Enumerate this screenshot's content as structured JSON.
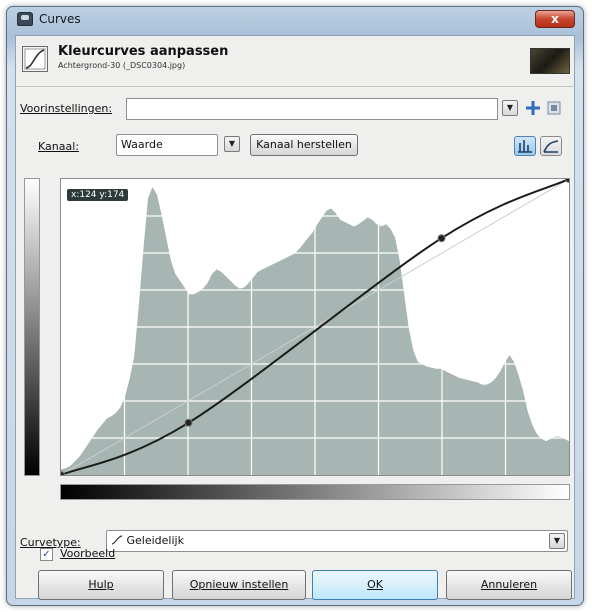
{
  "window": {
    "title": "Curves",
    "close_label": "x"
  },
  "header": {
    "title": "Kleurcurves aanpassen",
    "subtitle": "Achtergrond-30 (_DSC0304.jpg)"
  },
  "presets": {
    "label": "Voorinstellingen:",
    "value": ""
  },
  "channel": {
    "label": "Kanaal:",
    "value": "Waarde",
    "reset_label": "Kanaal herstellen"
  },
  "graph": {
    "coord_readout": "x:124 y:174",
    "curve_points": [
      [
        0,
        0
      ],
      [
        64,
        45
      ],
      [
        191,
        204
      ],
      [
        255,
        255
      ]
    ],
    "histogram": [
      5,
      6,
      8,
      12,
      16,
      22,
      28,
      34,
      40,
      45,
      50,
      52,
      55,
      60,
      70,
      85,
      105,
      150,
      200,
      245,
      255,
      248,
      230,
      210,
      190,
      178,
      172,
      166,
      160,
      160,
      162,
      165,
      170,
      178,
      182,
      180,
      176,
      172,
      168,
      165,
      166,
      170,
      175,
      180,
      182,
      184,
      186,
      188,
      190,
      192,
      194,
      196,
      200,
      205,
      210,
      215,
      222,
      228,
      234,
      236,
      232,
      226,
      224,
      222,
      220,
      222,
      225,
      228,
      226,
      222,
      220,
      222,
      218,
      210,
      190,
      160,
      130,
      110,
      100,
      98,
      96,
      95,
      94,
      94,
      92,
      90,
      88,
      86,
      85,
      84,
      83,
      82,
      80,
      80,
      82,
      86,
      92,
      100,
      106,
      100,
      88,
      74,
      56,
      44,
      36,
      32,
      30,
      32,
      34,
      34,
      32,
      30
    ],
    "hist_color": "#a8b6b3",
    "curve_color": "#1c1c1c"
  },
  "curve_type": {
    "label": "Curvetype:",
    "value": "Geleidelijk"
  },
  "preview": {
    "label": "Voorbeeld",
    "checked": true
  },
  "buttons": {
    "help": "Hulp",
    "reset": "Opnieuw instellen",
    "ok": "OK",
    "cancel": "Annuleren"
  }
}
